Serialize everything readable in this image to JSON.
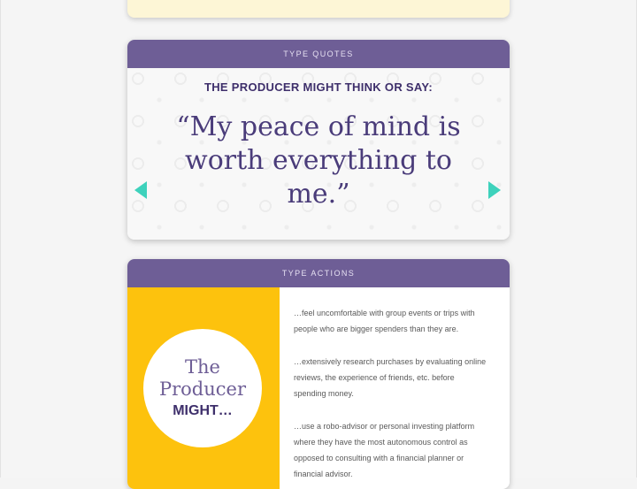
{
  "quotes_card": {
    "header": "TYPE QUOTES",
    "heading": "THE PRODUCER MIGHT THINK OR SAY:",
    "quote": "“My peace of mind is worth everything to me.”",
    "carousel_dots": 4,
    "active_dot": 2,
    "accent_color": "#3ed2bc"
  },
  "actions_card": {
    "header": "TYPE ACTIONS",
    "circle": {
      "line1": "The",
      "line2": "Producer",
      "line3": "MIGHT…"
    },
    "items": [
      "…feel uncomfortable with group events or trips with people who are bigger spenders than they are.",
      "…extensively research purchases by evaluating online reviews, the experience of friends, etc. before spending money.",
      "…use a robo-advisor or personal investing platform where they have the most autonomous control as opposed to consulting with a financial planner or financial advisor."
    ]
  },
  "colors": {
    "header_purple": "#6e5e96",
    "dark_purple": "#3e2f6b",
    "yellow": "#fdc20d",
    "cream": "#fdf6d6"
  }
}
